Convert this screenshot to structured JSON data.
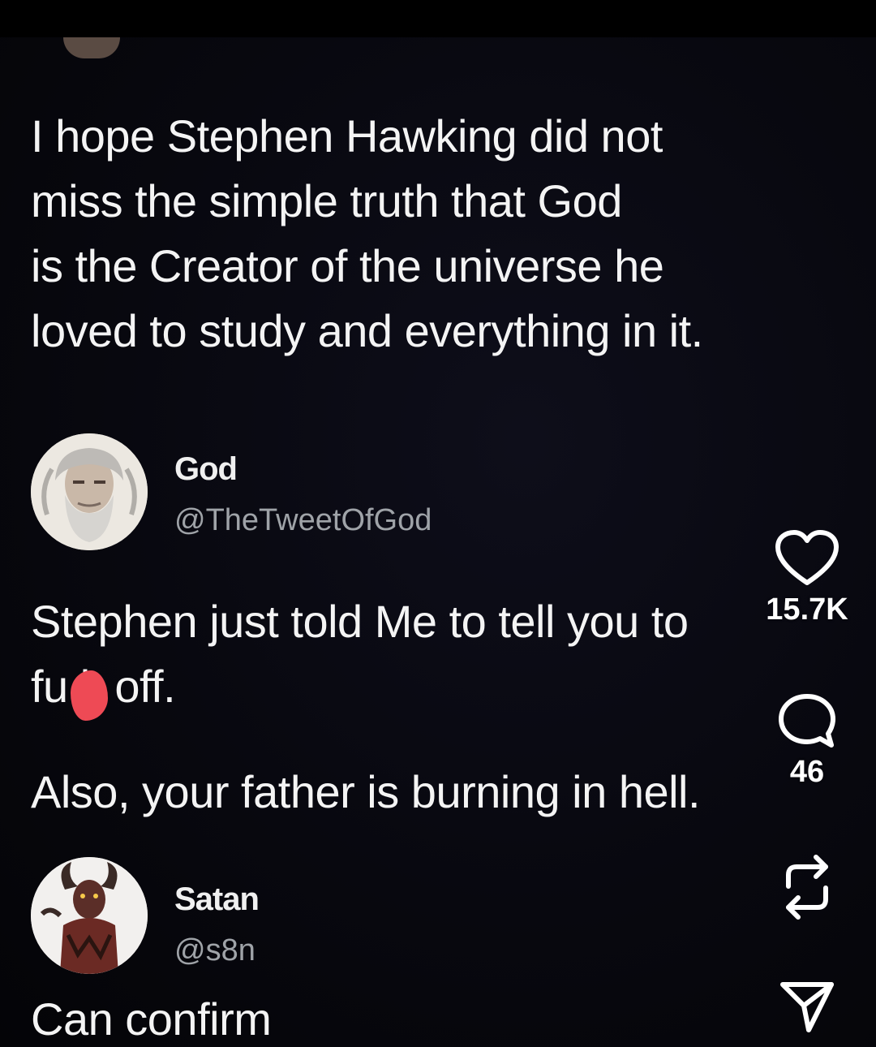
{
  "post": {
    "tweet1": {
      "text": "I hope Stephen Hawking did not\nmiss the simple truth that God\nis the Creator of the universe he\nloved to study and everything in it."
    },
    "tweet2": {
      "author_name": "God",
      "author_handle": "@TheTweetOfGod",
      "line1": "Stephen just told Me to tell you to",
      "line2": "fu  k off.",
      "line3": "Also, your father is burning in hell."
    },
    "tweet3": {
      "author_name": "Satan",
      "author_handle": "@s8n",
      "text": "Can confirm"
    }
  },
  "actions": {
    "like": {
      "icon": "heart-icon",
      "count": "15.7K"
    },
    "comment": {
      "icon": "comment-icon",
      "count": "46"
    },
    "repost": {
      "icon": "repost-icon"
    },
    "share": {
      "icon": "send-icon"
    }
  },
  "colors": {
    "background": "#07070d",
    "text": "#f4f4f4",
    "handle": "#9fa3a8",
    "censor": "#ee4a55"
  }
}
